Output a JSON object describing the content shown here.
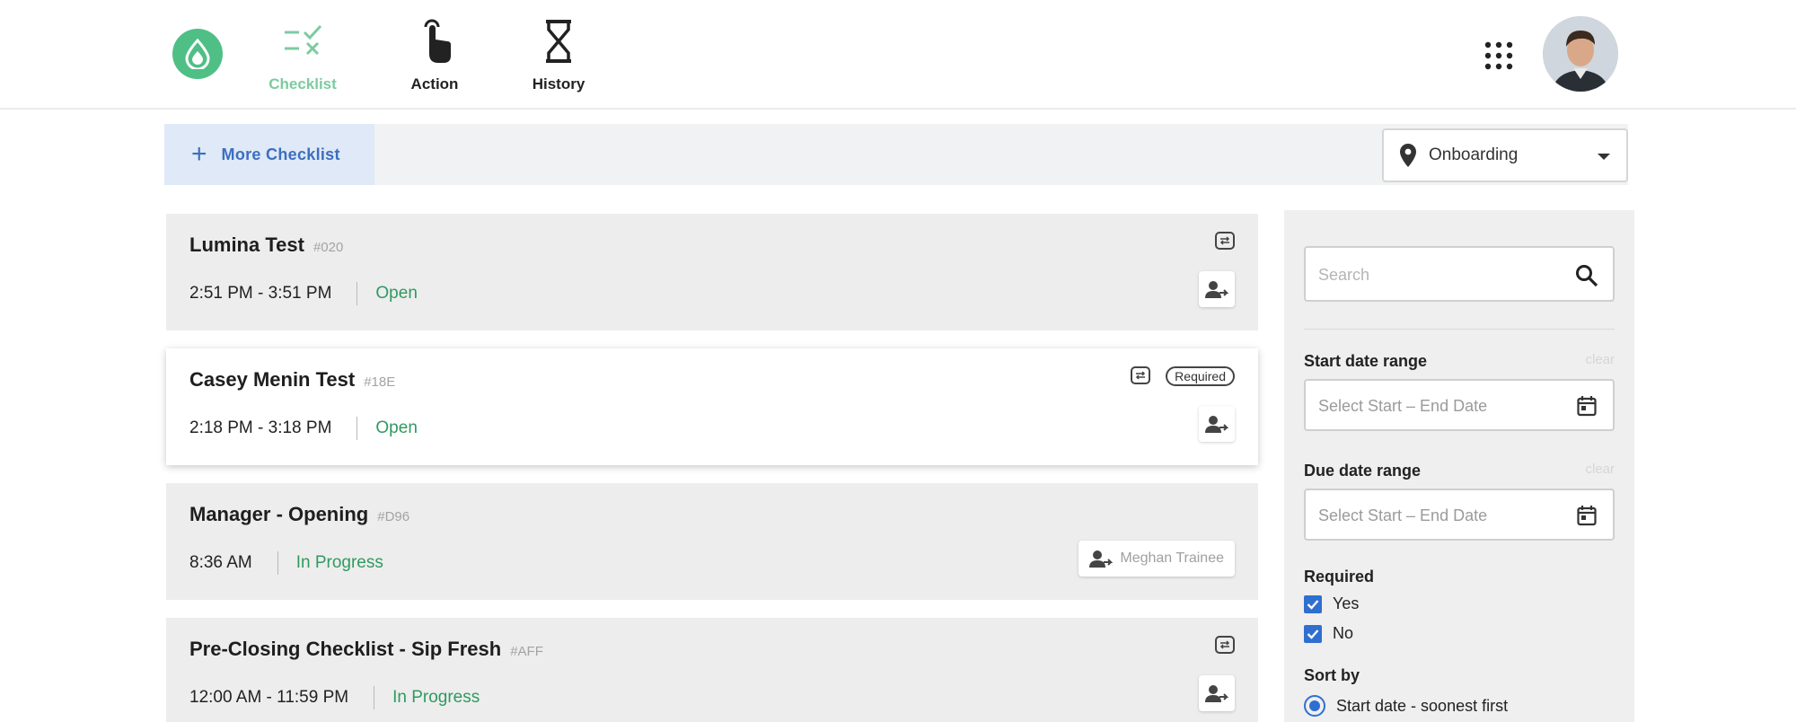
{
  "nav": {
    "tabs": [
      {
        "label": "Checklist",
        "icon": "checklist-icon",
        "active": true
      },
      {
        "label": "Action",
        "icon": "tap-icon",
        "active": false
      },
      {
        "label": "History",
        "icon": "hourglass-icon",
        "active": false
      }
    ]
  },
  "toolbar": {
    "more_label": "More Checklist",
    "location": "Onboarding"
  },
  "checklists": [
    {
      "title": "Lumina Test",
      "code": "#020",
      "time": "2:51 PM - 3:51 PM",
      "status": "Open",
      "recurring": true,
      "required": false,
      "assignee": ""
    },
    {
      "title": "Casey Menin Test",
      "code": "#18E",
      "time": "2:18 PM - 3:18 PM",
      "status": "Open",
      "recurring": true,
      "required": true,
      "required_label": "Required",
      "assignee": ""
    },
    {
      "title": "Manager - Opening",
      "code": "#D96",
      "time": "8:36 AM",
      "status": "In Progress",
      "recurring": false,
      "required": false,
      "assignee": "Meghan Trainee"
    },
    {
      "title": "Pre-Closing Checklist - Sip Fresh",
      "code": "#AFF",
      "time": "12:00 AM - 11:59 PM",
      "status": "In Progress",
      "recurring": true,
      "required": false,
      "assignee": ""
    }
  ],
  "filters": {
    "search_placeholder": "Search",
    "start_label": "Start date range",
    "due_label": "Due date range",
    "clear_label": "clear",
    "date_placeholder": "Select Start  – End Date",
    "required_label": "Required",
    "required_options": [
      "Yes",
      "No"
    ],
    "sort_label": "Sort by",
    "sort_option": "Start date - soonest first"
  },
  "colors": {
    "accent_green": "#4fbf86",
    "status_green": "#2f9a60",
    "primary_blue": "#2f6fd0"
  }
}
